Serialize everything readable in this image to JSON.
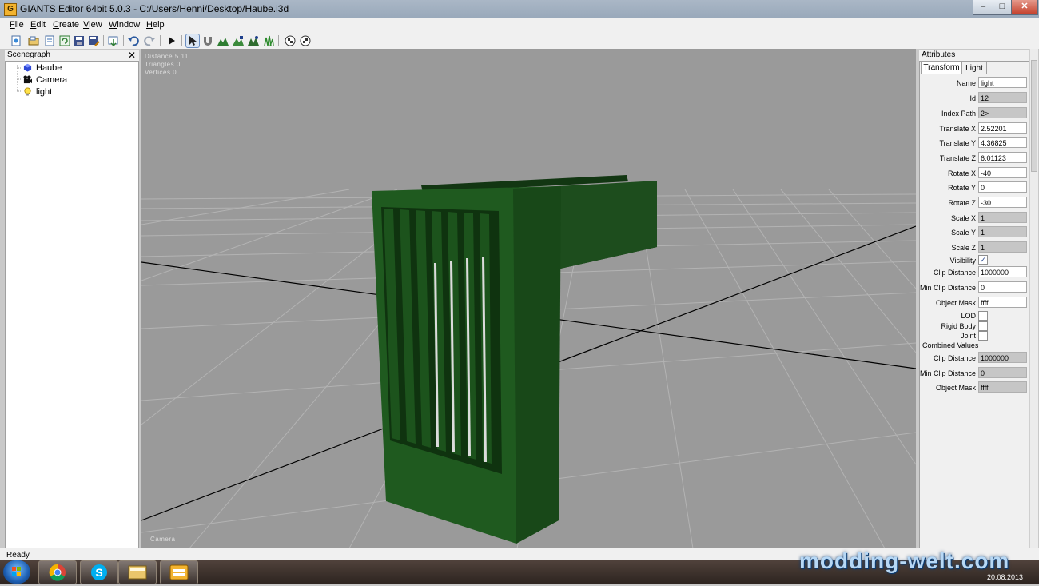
{
  "window": {
    "title": "GIANTS Editor 64bit 5.0.3 - C:/Users/Henni/Desktop/Haube.i3d",
    "app_icon": "giants-editor-icon"
  },
  "window_controls": {
    "minimize": "–",
    "maximize": "□",
    "close": "✕"
  },
  "menu": [
    {
      "key": "file",
      "underline": "F",
      "rest": "ile"
    },
    {
      "key": "edit",
      "underline": "E",
      "rest": "dit"
    },
    {
      "key": "create",
      "underline": "C",
      "rest": "reate"
    },
    {
      "key": "view",
      "underline": "V",
      "rest": "iew"
    },
    {
      "key": "window",
      "underline": "W",
      "rest": "indow"
    },
    {
      "key": "help",
      "underline": "H",
      "rest": "elp"
    }
  ],
  "toolbar_icons": [
    "new-file-icon",
    "open-file-icon",
    "open-list-icon",
    "refresh-icon",
    "save-icon",
    "save-as-icon",
    "import-icon",
    "undo-icon",
    "redo-icon",
    "play-icon",
    "select-tool-icon",
    "magnet-icon",
    "terrain-sculpt-icon",
    "terrain-paint-icon",
    "foliage-paint-icon",
    "grass-paint-icon",
    "texture-paint-icon",
    "decal-paint-icon"
  ],
  "scenegraph": {
    "title": "Scenegraph",
    "close": "✕",
    "nodes": [
      {
        "label": "Haube",
        "icon": "shape-cube-icon"
      },
      {
        "label": "Camera",
        "icon": "camera-icon"
      },
      {
        "label": "light",
        "icon": "light-bulb-icon"
      }
    ]
  },
  "viewport": {
    "info": {
      "distance": "Distance 5.11",
      "triangles": "Triangles 0",
      "vertices": "Vertices 0"
    },
    "camera_label": "Camera",
    "model_color": "#1f5a1f"
  },
  "attributes": {
    "title": "Attributes",
    "close": "✕",
    "tabs": [
      {
        "label": "Transform",
        "active": true
      },
      {
        "label": "Light",
        "active": false
      }
    ],
    "fields": [
      {
        "label": "Name",
        "value": "light",
        "readonly": false
      },
      {
        "label": "Id",
        "value": "12",
        "readonly": true
      },
      {
        "label": "Index Path",
        "value": "2>",
        "readonly": true
      },
      {
        "label": "Translate X",
        "value": "2.52201",
        "readonly": false
      },
      {
        "label": "Translate Y",
        "value": "4.36825",
        "readonly": false
      },
      {
        "label": "Translate Z",
        "value": "6.01123",
        "readonly": false
      },
      {
        "label": "Rotate X",
        "value": "-40",
        "readonly": false
      },
      {
        "label": "Rotate Y",
        "value": "0",
        "readonly": false
      },
      {
        "label": "Rotate Z",
        "value": "-30",
        "readonly": false
      },
      {
        "label": "Scale X",
        "value": "1",
        "readonly": true
      },
      {
        "label": "Scale Y",
        "value": "1",
        "readonly": true
      },
      {
        "label": "Scale Z",
        "value": "1",
        "readonly": true
      }
    ],
    "visibility": {
      "label": "Visibility",
      "checked": true,
      "mark": "✓"
    },
    "fields2": [
      {
        "label": "Clip Distance",
        "value": "1000000",
        "readonly": false
      },
      {
        "label": "Min Clip Distance",
        "value": "0",
        "readonly": false
      },
      {
        "label": "Object Mask",
        "value": "ffff",
        "readonly": false
      }
    ],
    "checks": [
      {
        "label": "LOD",
        "checked": false
      },
      {
        "label": "Rigid Body",
        "checked": false
      },
      {
        "label": "Joint",
        "checked": false
      }
    ],
    "combined_title": "Combined Values",
    "combined": [
      {
        "label": "Clip Distance",
        "value": "1000000",
        "readonly": true
      },
      {
        "label": "Min Clip Distance",
        "value": "0",
        "readonly": true
      },
      {
        "label": "Object Mask",
        "value": "ffff",
        "readonly": true
      }
    ]
  },
  "status": {
    "text": "Ready"
  },
  "taskbar": {
    "apps": [
      "chrome-icon",
      "skype-icon",
      "file-explorer-icon",
      "giants-editor-icon"
    ],
    "date": "20.08.2013"
  },
  "watermark": "modding-welt.com"
}
